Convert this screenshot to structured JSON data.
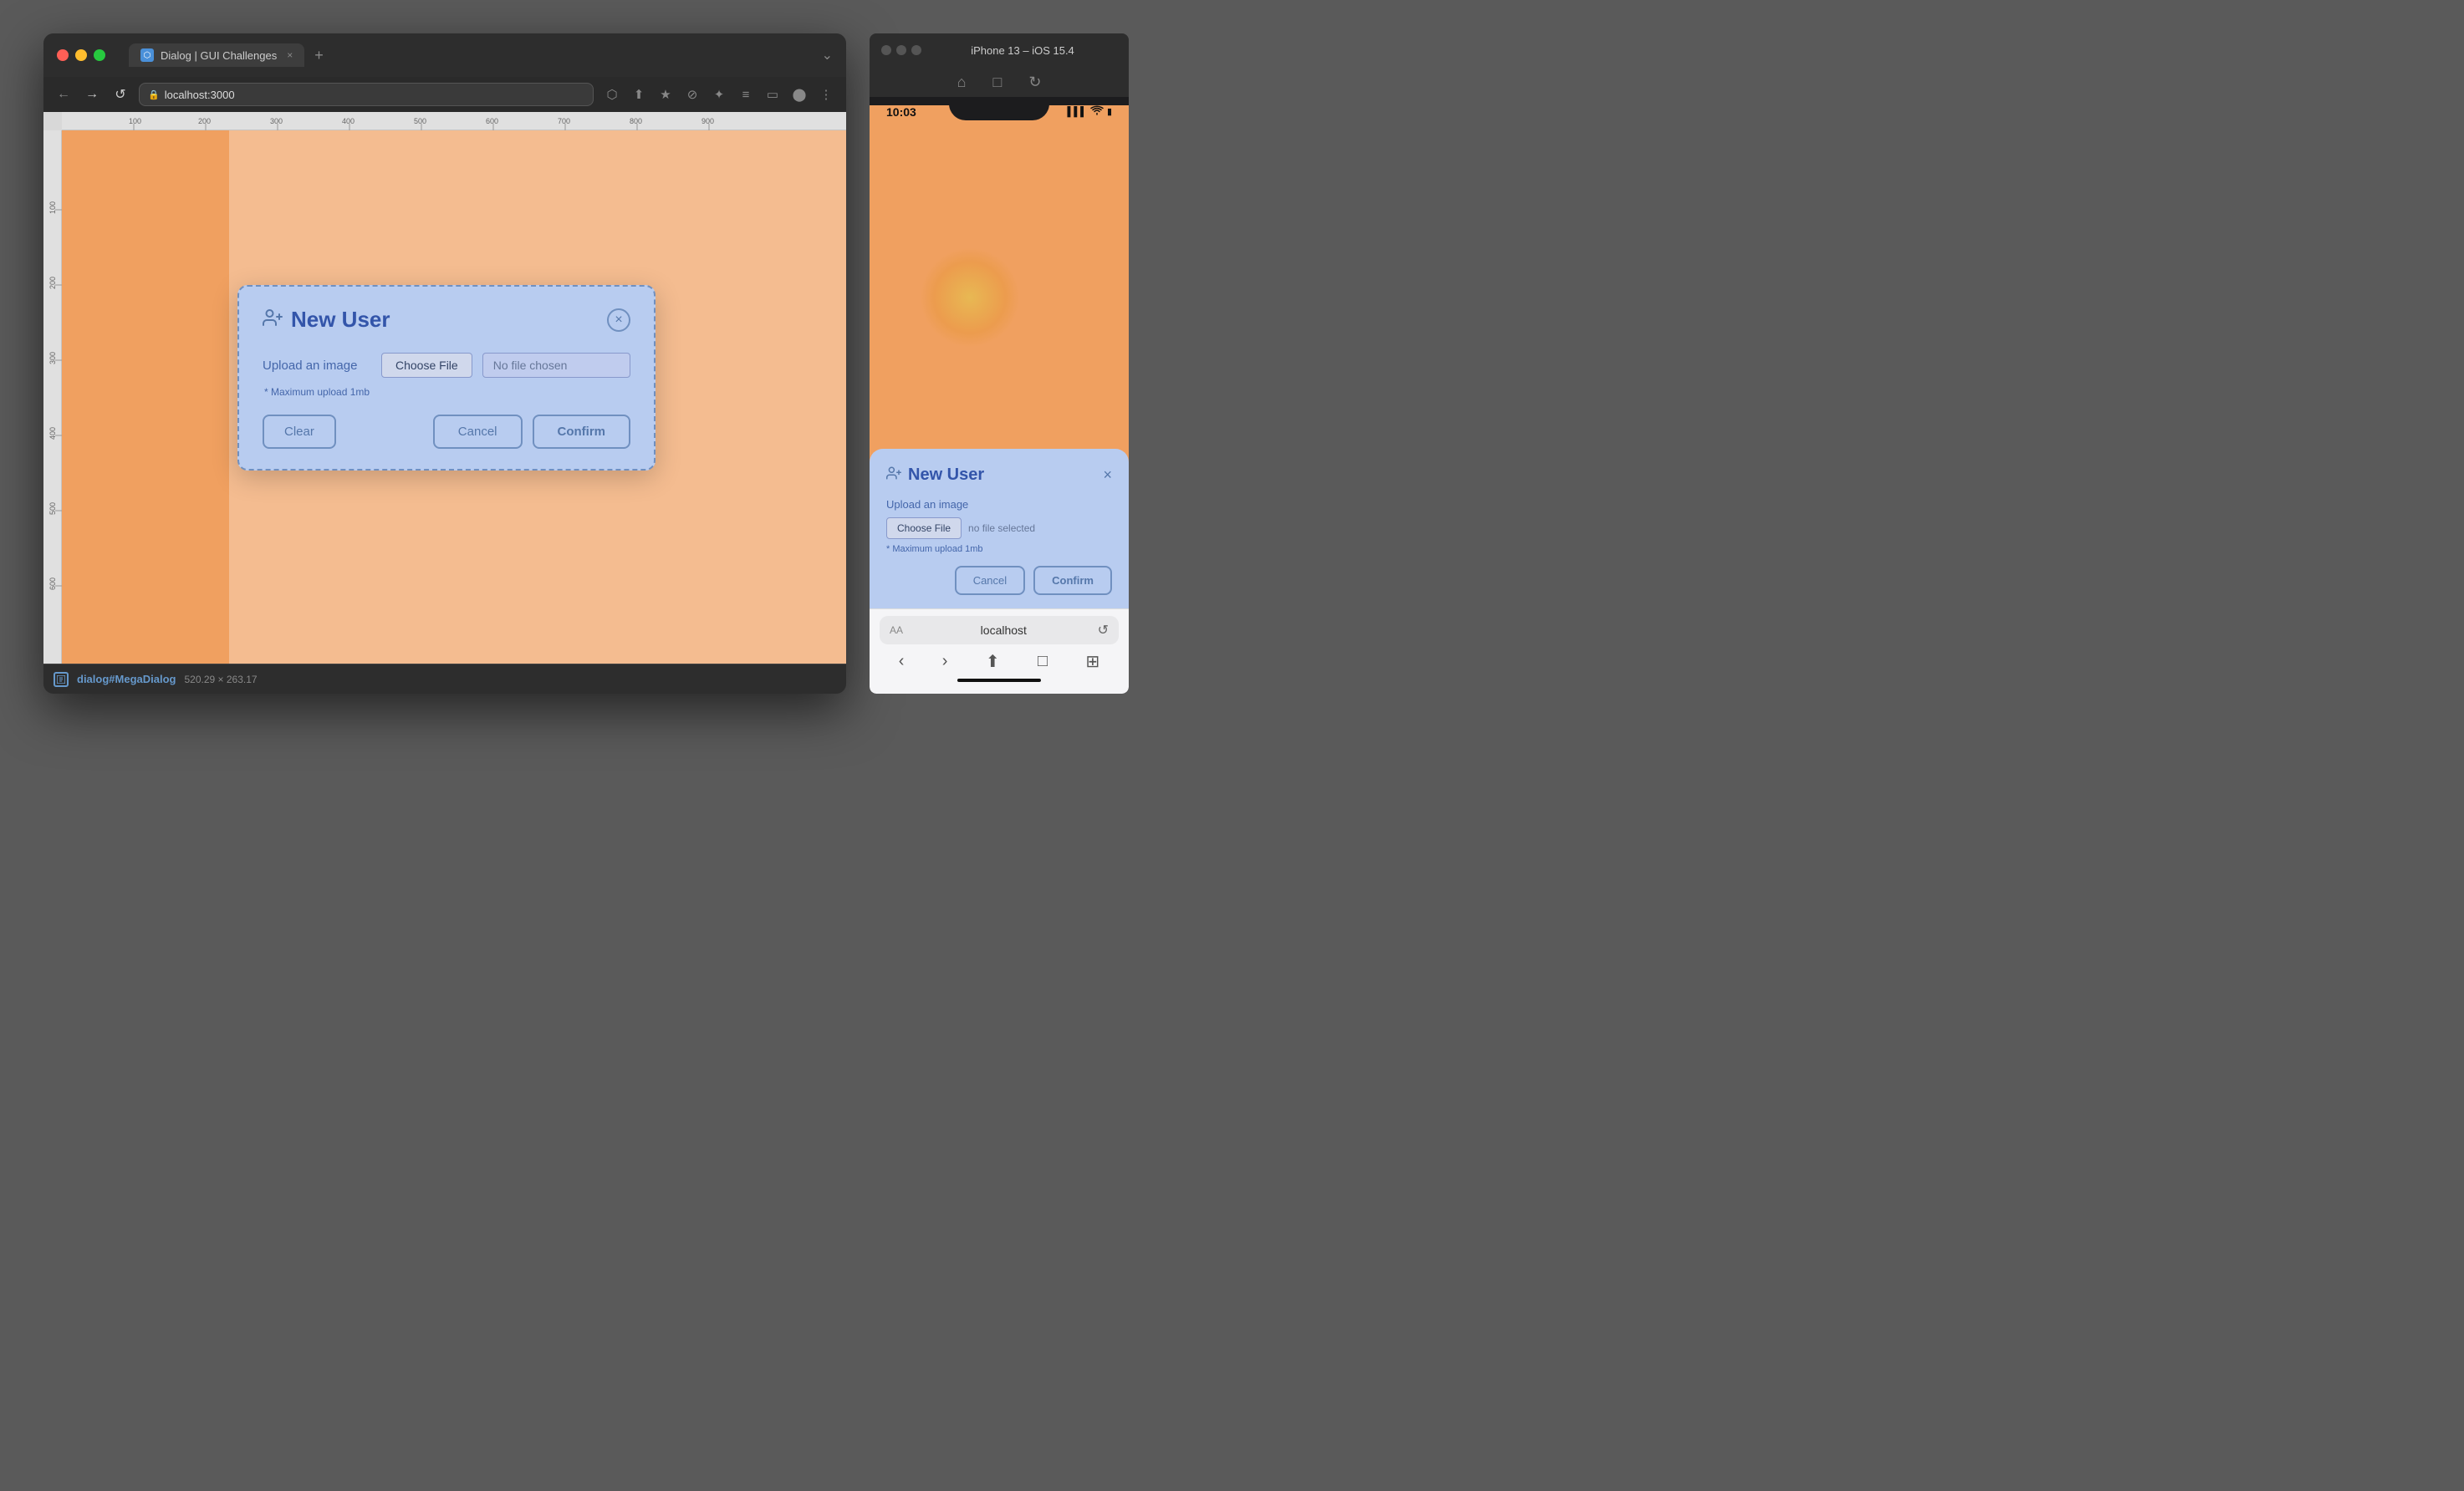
{
  "browser": {
    "tab_title": "Dialog | GUI Challenges",
    "address": "localhost:3000",
    "close_label": "×",
    "new_tab_label": "+",
    "chevron_label": "⌄",
    "nav": {
      "back": "←",
      "forward": "→",
      "refresh": "↺"
    },
    "toolbar_icons": [
      "⬡",
      "⬆",
      "★",
      "⊘",
      "✦",
      "≡",
      "▭",
      "⬤",
      "⋮"
    ]
  },
  "dialog_desktop": {
    "title": "New User",
    "close_label": "×",
    "upload_label": "Upload an image",
    "choose_file_label": "Choose File",
    "no_file_label": "No file chosen",
    "hint": "* Maximum upload 1mb",
    "clear_label": "Clear",
    "cancel_label": "Cancel",
    "confirm_label": "Confirm"
  },
  "dialog_mobile": {
    "title": "New User",
    "close_label": "×",
    "upload_label": "Upload an image",
    "choose_file_label": "Choose File",
    "no_file_label": "no file selected",
    "hint": "* Maximum upload 1mb",
    "cancel_label": "Cancel",
    "confirm_label": "Confirm"
  },
  "iphone": {
    "header_title": "iPhone 13 – iOS 15.4",
    "time": "10:03",
    "signal": "▌▌▌",
    "wifi": "wifi",
    "battery": "▮",
    "url_label": "AA",
    "url_text": "localhost",
    "reload_icon": "↺"
  },
  "status_bar": {
    "element_label": "dialog#MegaDialog",
    "dimensions": "520.29 × 263.17"
  },
  "rulers": {
    "marks": [
      "100",
      "200",
      "300",
      "400",
      "500",
      "600",
      "700",
      "800",
      "900"
    ]
  }
}
